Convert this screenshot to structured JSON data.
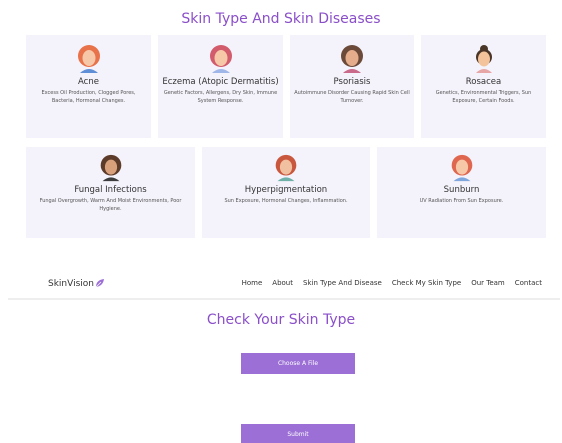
{
  "diseases_section": {
    "title": "Skin Type And Skin Diseases",
    "cards": [
      {
        "name": "Acne",
        "description": "Excess Oil Production, Clogged Pores, Bacteria, Hormonal Changes.",
        "hair_color": "#e8724a",
        "face_color": "#f6c8a8"
      },
      {
        "name": "Eczema (Atopic Dermatitis)",
        "description": "Genetic Factors, Allergens, Dry Skin, Immune System Response.",
        "hair_color": "#d25b6c",
        "face_color": "#f6c8a8"
      },
      {
        "name": "Psoriasis",
        "description": "Autoimmune Disorder Causing Rapid Skin Cell Turnover.",
        "hair_color": "#6b4a3a",
        "face_color": "#e6ad8c"
      },
      {
        "name": "Rosacea",
        "description": "Genetics, Environmental Triggers, Sun Exposure, Certain Foods.",
        "hair_color": "#4a3628",
        "face_color": "#f3c39c"
      },
      {
        "name": "Fungal Infections",
        "description": "Fungal Overgrowth, Warm And Moist Environments, Poor Hygiene.",
        "hair_color": "#5c3b2a",
        "face_color": "#d9a07c"
      },
      {
        "name": "Hyperpigmentation",
        "description": "Sun Exposure, Hormonal Changes, Inflammation.",
        "hair_color": "#c9573d",
        "face_color": "#f1c0a0"
      },
      {
        "name": "Sunburn",
        "description": "UV Radiation From Sun Exposure.",
        "hair_color": "#e0674f",
        "face_color": "#f6c8a8"
      }
    ]
  },
  "navbar": {
    "brand": "SkinVision",
    "brand_icon": "leaf-icon",
    "links": [
      "Home",
      "About",
      "Skin Type And Disease",
      "Check My Skin Type",
      "Our Team",
      "Contact"
    ]
  },
  "check_section": {
    "title": "Check Your Skin Type",
    "choose_label": "Choose A File",
    "submit_label": "Submit"
  },
  "colors": {
    "accent": "#8a4fc9",
    "button": "#9b6fd6",
    "card_bg": "#f4f2fa"
  }
}
